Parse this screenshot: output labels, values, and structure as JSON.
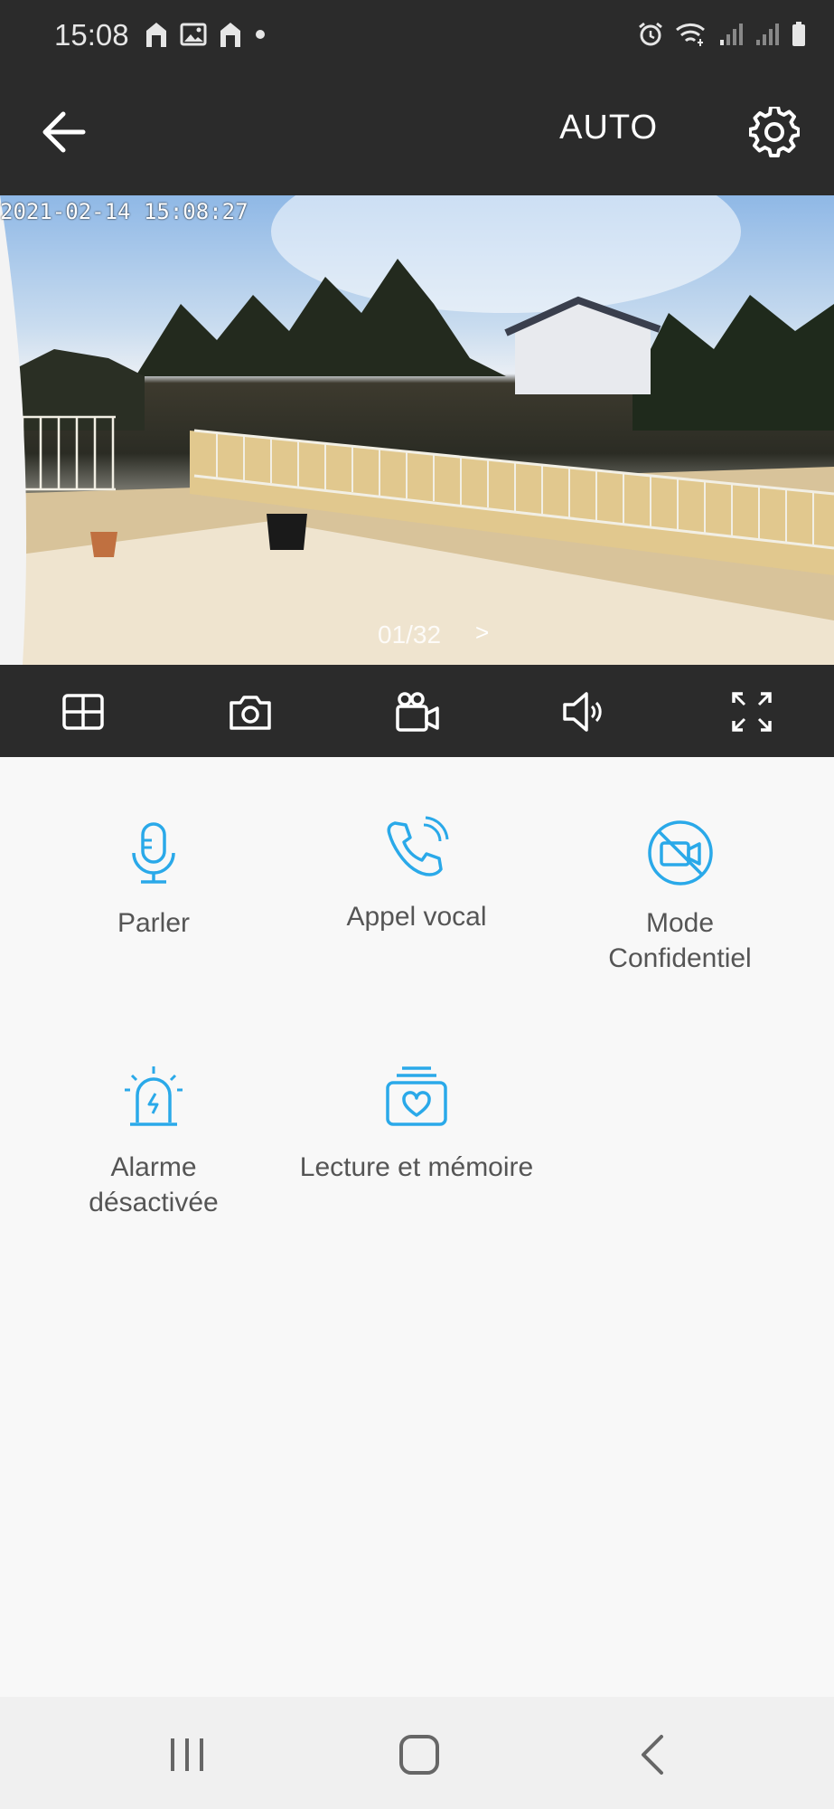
{
  "status_bar": {
    "time": "15:08",
    "left_icons": [
      "home-icon",
      "image-icon",
      "home-icon",
      "dot-icon"
    ],
    "right_icons": [
      "alarm-icon",
      "wifi-icon",
      "signal-icon",
      "signal-icon",
      "battery-icon"
    ]
  },
  "app_bar": {
    "mode_label": "AUTO",
    "icons": {
      "back": "arrow-left-icon",
      "settings": "gear-icon"
    }
  },
  "video": {
    "timestamp": "2021-02-14 15:08:27",
    "page_indicator": "01/32",
    "next_label": ">"
  },
  "toolbar": {
    "icons": [
      "grid-icon",
      "camera-icon",
      "video-record-icon",
      "speaker-icon",
      "fullscreen-icon"
    ]
  },
  "actions": [
    {
      "label": "Parler",
      "icon": "microphone-icon"
    },
    {
      "label": "Appel vocal",
      "icon": "phone-call-icon"
    },
    {
      "label_line1": "Mode",
      "label_line2": "Confidentiel",
      "icon": "camera-off-icon"
    },
    {
      "label_line1": "Alarme",
      "label_line2": "désactivée",
      "icon": "siren-icon"
    },
    {
      "label": "Lecture et mémoire",
      "icon": "memory-heart-icon"
    }
  ],
  "nav_bar": {
    "icons": [
      "recent-apps-icon",
      "home-button-icon",
      "back-nav-icon"
    ]
  },
  "colors": {
    "accent": "#2aa9e9",
    "dark_bar": "#2b2b2b",
    "label": "#555555"
  }
}
